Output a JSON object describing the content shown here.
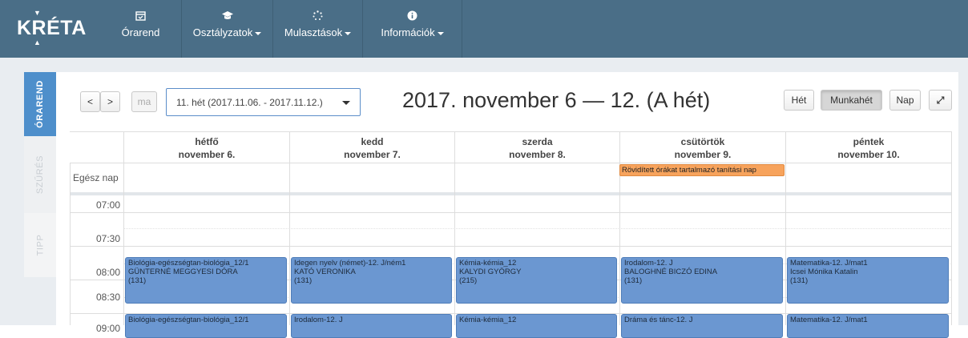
{
  "brand": {
    "name": "KRÉTA"
  },
  "nav": {
    "items": [
      {
        "label": "Órarend",
        "icon": "calendar-icon"
      },
      {
        "label": "Osztályzatok",
        "icon": "graduation-cap-icon"
      },
      {
        "label": "Mulasztások",
        "icon": "spinner-icon"
      },
      {
        "label": "Információk",
        "icon": "info-icon"
      }
    ]
  },
  "side_tabs": [
    "ÓRAREND",
    "SZŰRÉS",
    "TIPP"
  ],
  "toolbar": {
    "prev": "<",
    "next": ">",
    "today": "ma",
    "week_value": "11. hét (2017.11.06. - 2017.11.12.)",
    "title": "2017. november 6 — 12. (A hét)",
    "views": [
      "Hét",
      "Munkahét",
      "Nap"
    ],
    "active_view": "Munkahét",
    "fullscreen": "⤢"
  },
  "calendar": {
    "all_day_label": "Egész nap",
    "days": [
      {
        "name": "hétfő",
        "date": "november 6."
      },
      {
        "name": "kedd",
        "date": "november 7."
      },
      {
        "name": "szerda",
        "date": "november 8."
      },
      {
        "name": "csütörtök",
        "date": "november 9."
      },
      {
        "name": "péntek",
        "date": "november 10."
      }
    ],
    "times": [
      "07:00",
      "07:30",
      "08:00",
      "08:30",
      "09:00"
    ],
    "all_day_event": {
      "day": 3,
      "text": "Rövidített órákat tartalmazó tanítási nap",
      "color": "#f7a35c"
    },
    "events_0800": [
      {
        "subject": "Biológia-egészségtan-biológia_12/1",
        "teacher": "GÜNTERNÉ MEGGYESI DÓRA",
        "room": "(131)"
      },
      {
        "subject": "Idegen nyelv (német)-12. J/ném1",
        "teacher": "KATÓ VERONIKA",
        "room": "(131)"
      },
      {
        "subject": "Kémia-kémia_12",
        "teacher": "KALYDI GYÖRGY",
        "room": "(215)"
      },
      {
        "subject": "Irodalom-12. J",
        "teacher": "BALOGHNÉ BICZÓ EDINA",
        "room": "(131)"
      },
      {
        "subject": "Matematika-12. J/mat1",
        "teacher": "Icsei Mónika Katalin",
        "room": "(131)"
      }
    ],
    "events_0900": [
      {
        "subject": "Biológia-egészségtan-biológia_12/1"
      },
      {
        "subject": "Irodalom-12. J"
      },
      {
        "subject": "Kémia-kémia_12"
      },
      {
        "subject": "Dráma és tánc-12. J"
      },
      {
        "subject": "Matematika-12. J/mat1"
      }
    ],
    "event_color": "#6b97d1"
  }
}
